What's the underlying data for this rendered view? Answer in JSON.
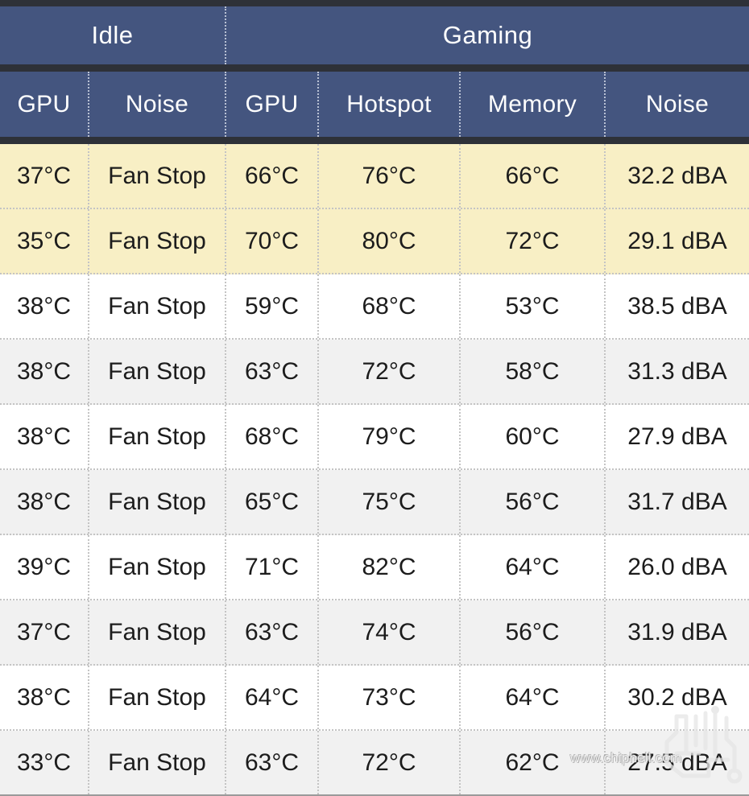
{
  "table": {
    "group_headers": [
      {
        "label": "Idle",
        "span": 2
      },
      {
        "label": "Gaming",
        "span": 4
      }
    ],
    "columns": [
      "GPU",
      "Noise",
      "GPU",
      "Hotspot",
      "Memory",
      "Noise"
    ],
    "rows": [
      {
        "highlight": true,
        "cells": [
          "37°C",
          "Fan Stop",
          "66°C",
          "76°C",
          "66°C",
          "32.2 dBA"
        ]
      },
      {
        "highlight": true,
        "cells": [
          "35°C",
          "Fan Stop",
          "70°C",
          "80°C",
          "72°C",
          "29.1 dBA"
        ]
      },
      {
        "highlight": false,
        "cells": [
          "38°C",
          "Fan Stop",
          "59°C",
          "68°C",
          "53°C",
          "38.5 dBA"
        ]
      },
      {
        "highlight": false,
        "cells": [
          "38°C",
          "Fan Stop",
          "63°C",
          "72°C",
          "58°C",
          "31.3 dBA"
        ]
      },
      {
        "highlight": false,
        "cells": [
          "38°C",
          "Fan Stop",
          "68°C",
          "79°C",
          "60°C",
          "27.9 dBA"
        ]
      },
      {
        "highlight": false,
        "cells": [
          "38°C",
          "Fan Stop",
          "65°C",
          "75°C",
          "56°C",
          "31.7 dBA"
        ]
      },
      {
        "highlight": false,
        "cells": [
          "39°C",
          "Fan Stop",
          "71°C",
          "82°C",
          "64°C",
          "26.0 dBA"
        ]
      },
      {
        "highlight": false,
        "cells": [
          "37°C",
          "Fan Stop",
          "63°C",
          "74°C",
          "56°C",
          "31.9 dBA"
        ]
      },
      {
        "highlight": false,
        "cells": [
          "38°C",
          "Fan Stop",
          "64°C",
          "73°C",
          "64°C",
          "30.2 dBA"
        ]
      },
      {
        "highlight": false,
        "cells": [
          "33°C",
          "Fan Stop",
          "63°C",
          "72°C",
          "62°C",
          "27.5 dBA"
        ]
      }
    ]
  },
  "watermark": {
    "url": "www.chiphell.com",
    "logo_name": "chiphell-logo"
  },
  "colors": {
    "header_blue": "#44557f",
    "header_text": "#ffffff",
    "rule_dark": "#2e3138",
    "highlight_row": "#f8efc5",
    "zebra_row": "#f1f1f1",
    "plain_row": "#ffffff",
    "body_text": "#1c1c1c",
    "grid_dotted": "#c4c4c4"
  }
}
